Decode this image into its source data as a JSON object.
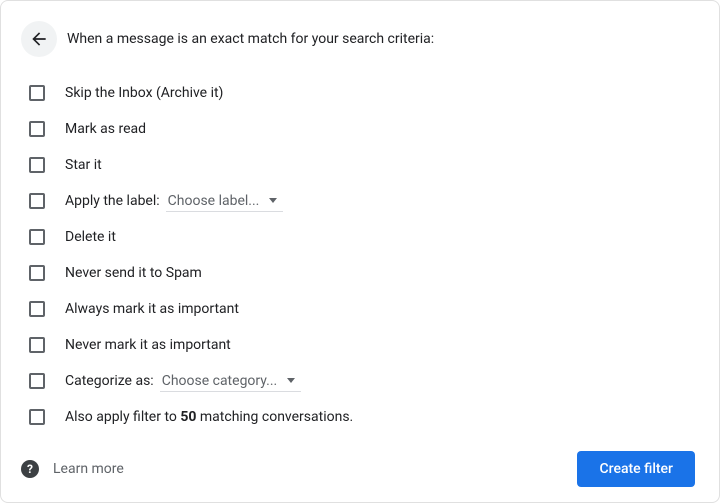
{
  "header": {
    "heading": "When a message is an exact match for your search criteria:"
  },
  "options": {
    "skip_inbox": "Skip the Inbox (Archive it)",
    "mark_read": "Mark as read",
    "star": "Star it",
    "apply_label_prefix": "Apply the label:",
    "apply_label_select": "Choose label...",
    "delete": "Delete it",
    "never_spam": "Never send it to Spam",
    "always_important": "Always mark it as important",
    "never_important": "Never mark it as important",
    "categorize_prefix": "Categorize as:",
    "categorize_select": "Choose category...",
    "also_apply_prefix": "Also apply filter to ",
    "also_apply_count": "50",
    "also_apply_suffix": " matching conversations."
  },
  "footer": {
    "learn_more": "Learn more",
    "create_filter": "Create filter"
  }
}
